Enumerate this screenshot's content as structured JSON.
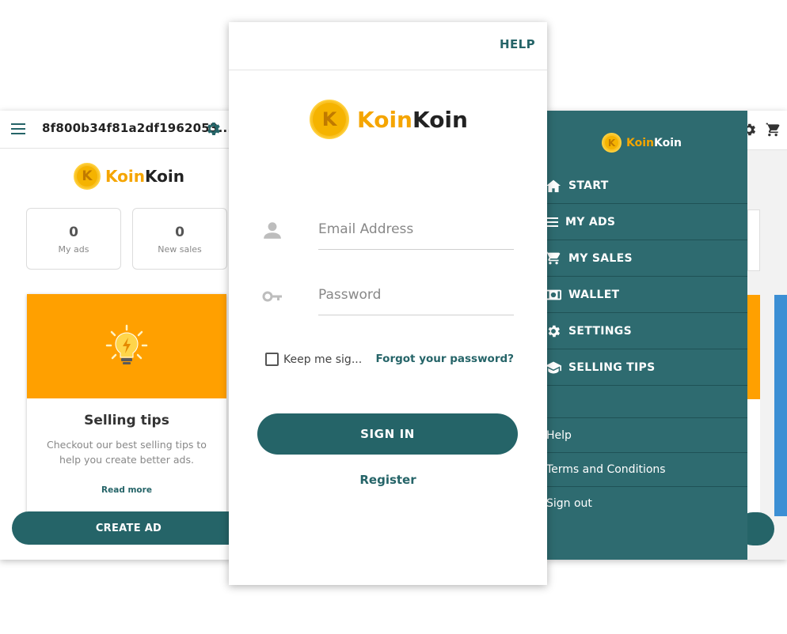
{
  "left_screen": {
    "header_title": "8f800b34f81a2df1962053...",
    "logo": {
      "part1": "Koin",
      "part2": "Koin",
      "coin_letter": "K"
    },
    "stats": [
      {
        "value": "0",
        "label": "My ads"
      },
      {
        "value": "0",
        "label": "New sales"
      }
    ],
    "tip_card": {
      "title": "Selling tips",
      "text": "Checkout our best selling tips to help you create better ads.",
      "link": "Read more"
    },
    "create_button": "CREATE AD"
  },
  "center_screen": {
    "help_label": "HELP",
    "logo": {
      "part1": "Koin",
      "part2": "Koin",
      "coin_letter": "K"
    },
    "email_placeholder": "Email Address",
    "password_placeholder": "Password",
    "keep_signed_label": "Keep me sig...",
    "forgot_link": "Forgot your password?",
    "signin_button": "SIGN IN",
    "register_link": "Register"
  },
  "right_screen": {
    "logo": {
      "part1": "Koin",
      "part2": "Koin",
      "coin_letter": "K"
    },
    "menu_items": [
      {
        "label": "START",
        "icon": "home-icon"
      },
      {
        "label": "MY ADS",
        "icon": "list-icon"
      },
      {
        "label": "MY SALES",
        "icon": "cart-icon"
      },
      {
        "label": "WALLET",
        "icon": "wallet-icon"
      },
      {
        "label": "SETTINGS",
        "icon": "gear-icon"
      },
      {
        "label": "SELLING TIPS",
        "icon": "graduation-cap-icon"
      }
    ],
    "links": [
      "Help",
      "Terms and Conditions",
      "Sign out"
    ]
  },
  "colors": {
    "primary": "#256468",
    "drawer": "#2e6b70",
    "accent_orange": "#ffa000",
    "coin_gold": "#f5b300"
  }
}
